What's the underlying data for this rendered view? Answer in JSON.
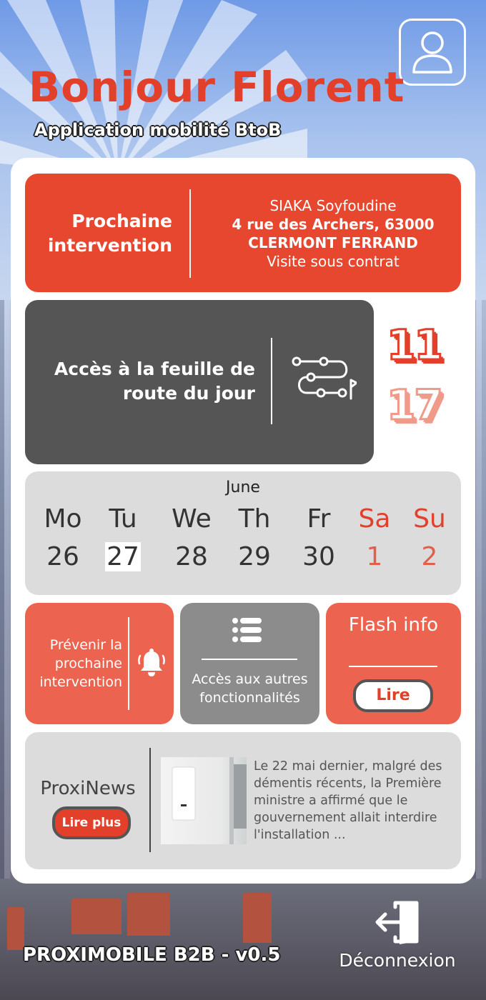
{
  "header": {
    "greeting": "Bonjour Florent",
    "subtitle": "Application mobilité BtoB"
  },
  "next_intervention": {
    "title": "Prochaine intervention",
    "client": "SIAKA Soyfoudine",
    "address_line": "4 rue des Archers, 63000",
    "city": "CLERMONT FERRAND",
    "visit_type": "Visite sous contrat"
  },
  "route": {
    "label": "Accès à la feuille de route du jour"
  },
  "counters": {
    "first": "11",
    "second": "17"
  },
  "calendar": {
    "month": "June",
    "days": [
      {
        "name": "Mo",
        "num": "26"
      },
      {
        "name": "Tu",
        "num": "27"
      },
      {
        "name": "We",
        "num": "28"
      },
      {
        "name": "Th",
        "num": "29"
      },
      {
        "name": "Fr",
        "num": "30"
      },
      {
        "name": "Sa",
        "num": "1"
      },
      {
        "name": "Su",
        "num": "2"
      }
    ]
  },
  "prevenir": {
    "label": "Prévenir la prochaine intervention"
  },
  "more": {
    "label": "Accès aux autres fonctionnalités"
  },
  "flash": {
    "title": "Flash info",
    "button": "Lire"
  },
  "news": {
    "title": "ProxiNews",
    "button": "Lire plus",
    "excerpt": "Le 22 mai dernier, malgré des démentis récents, la Première ministre a affirmé que le gouvernement allait interdire l'installation ..."
  },
  "footer": {
    "app_name": "PROXIMOBILE B2B - v0.5",
    "logout": "Déconnexion"
  },
  "colors": {
    "accent_red": "#e8472f",
    "dark_card": "#555555",
    "light_card": "#dcdcdc",
    "salmon": "#ec6450"
  },
  "icons": {
    "profile": "user-icon",
    "route": "route-icon",
    "bell": "bell-icon",
    "list": "list-icon",
    "logout": "logout-icon"
  }
}
